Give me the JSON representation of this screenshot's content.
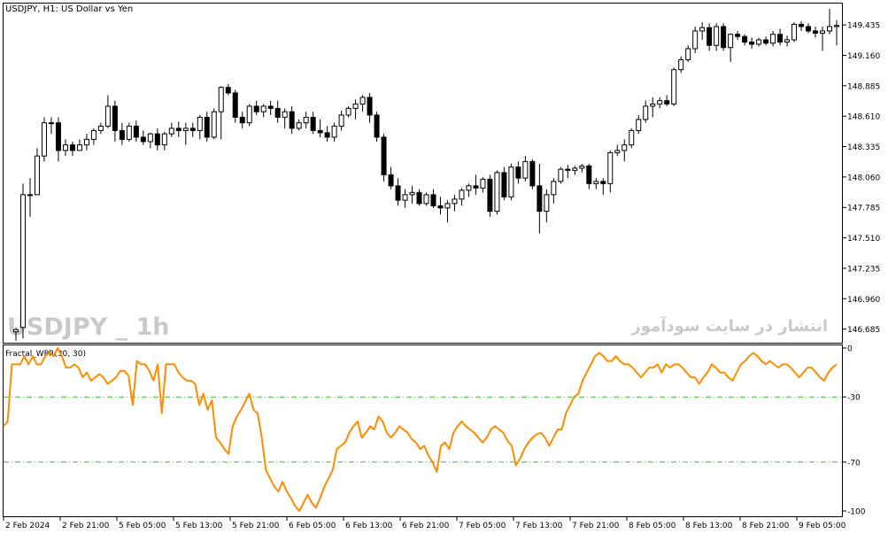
{
  "window": {
    "title": "USDJPY, H1:  US Dollar vs Yen",
    "watermark_left": "USDJPY _ 1h",
    "watermark_right": "انتشار در سایت سودآموز"
  },
  "indicator": {
    "label": "Fractal_WPR(30, 30)",
    "color": "#ff8c00",
    "level_color": "#33bb33",
    "levels": [
      -30,
      -70
    ],
    "tick_labels": [
      "0",
      "-30",
      "-70",
      "-100"
    ]
  },
  "price_axis": {
    "labels": [
      "149.435",
      "149.160",
      "148.885",
      "148.610",
      "148.335",
      "148.060",
      "147.785",
      "147.510",
      "147.235",
      "146.960",
      "146.685"
    ]
  },
  "time_axis": {
    "labels": [
      "2 Feb 2024",
      "2 Feb 21:00",
      "5 Feb 05:00",
      "5 Feb 13:00",
      "5 Feb 21:00",
      "6 Feb 05:00",
      "6 Feb 13:00",
      "6 Feb 21:00",
      "7 Feb 05:00",
      "7 Feb 13:00",
      "7 Feb 21:00",
      "8 Feb 05:00",
      "8 Feb 13:00",
      "8 Feb 21:00",
      "9 Feb 05:00"
    ]
  },
  "chart_data": [
    {
      "type": "candlestick",
      "title": "USDJPY, H1:  US Dollar vs Yen",
      "ylim": [
        146.57,
        149.62
      ],
      "candles": [
        [
          146.66,
          146.7,
          146.58,
          146.68
        ],
        [
          146.7,
          148.0,
          146.6,
          147.9
        ],
        [
          147.9,
          148.05,
          147.7,
          147.9
        ],
        [
          147.9,
          148.32,
          147.9,
          148.25
        ],
        [
          148.25,
          148.6,
          148.2,
          148.55
        ],
        [
          148.55,
          148.6,
          148.45,
          148.55
        ],
        [
          148.55,
          148.6,
          148.2,
          148.3
        ],
        [
          148.3,
          148.4,
          148.25,
          148.35
        ],
        [
          148.35,
          148.38,
          148.25,
          148.3
        ],
        [
          148.3,
          148.4,
          148.3,
          148.35
        ],
        [
          148.35,
          148.45,
          148.3,
          148.4
        ],
        [
          148.4,
          148.5,
          148.35,
          148.48
        ],
        [
          148.48,
          148.55,
          148.45,
          148.52
        ],
        [
          148.52,
          148.8,
          148.5,
          148.7
        ],
        [
          148.7,
          148.75,
          148.38,
          148.48
        ],
        [
          148.48,
          148.55,
          148.35,
          148.4
        ],
        [
          148.4,
          148.55,
          148.38,
          148.52
        ],
        [
          148.52,
          148.57,
          148.38,
          148.42
        ],
        [
          148.42,
          148.48,
          148.35,
          148.38
        ],
        [
          148.38,
          148.46,
          148.32,
          148.45
        ],
        [
          148.45,
          148.5,
          148.3,
          148.35
        ],
        [
          148.35,
          148.47,
          148.3,
          148.45
        ],
        [
          148.45,
          148.55,
          148.42,
          148.5
        ],
        [
          148.5,
          148.56,
          148.42,
          148.48
        ],
        [
          148.48,
          148.55,
          148.35,
          148.5
        ],
        [
          148.5,
          148.55,
          148.42,
          148.48
        ],
        [
          148.48,
          148.62,
          148.4,
          148.6
        ],
        [
          148.6,
          148.65,
          148.38,
          148.42
        ],
        [
          148.42,
          148.68,
          148.4,
          148.65
        ],
        [
          148.65,
          148.88,
          148.4,
          148.87
        ],
        [
          148.87,
          148.9,
          148.8,
          148.82
        ],
        [
          148.82,
          148.85,
          148.55,
          148.6
        ],
        [
          148.6,
          148.65,
          148.5,
          148.55
        ],
        [
          148.55,
          148.72,
          148.52,
          148.7
        ],
        [
          148.7,
          148.75,
          148.62,
          148.65
        ],
        [
          148.65,
          148.72,
          148.6,
          148.7
        ],
        [
          148.7,
          148.75,
          148.62,
          148.68
        ],
        [
          148.68,
          148.75,
          148.55,
          148.6
        ],
        [
          148.6,
          148.68,
          148.5,
          148.65
        ],
        [
          148.65,
          148.7,
          148.45,
          148.5
        ],
        [
          148.5,
          148.58,
          148.48,
          148.55
        ],
        [
          148.55,
          148.65,
          148.5,
          148.6
        ],
        [
          148.6,
          148.65,
          148.45,
          148.48
        ],
        [
          148.48,
          148.58,
          148.42,
          148.46
        ],
        [
          148.46,
          148.52,
          148.38,
          148.42
        ],
        [
          148.42,
          148.55,
          148.38,
          148.52
        ],
        [
          148.52,
          148.66,
          148.48,
          148.62
        ],
        [
          148.62,
          148.7,
          148.6,
          148.68
        ],
        [
          148.68,
          148.76,
          148.58,
          148.72
        ],
        [
          148.72,
          148.8,
          148.65,
          148.78
        ],
        [
          148.78,
          148.82,
          148.55,
          148.62
        ],
        [
          148.62,
          148.65,
          148.38,
          148.42
        ],
        [
          148.42,
          148.45,
          148.02,
          148.08
        ],
        [
          148.08,
          148.15,
          147.95,
          147.98
        ],
        [
          147.98,
          148.05,
          147.8,
          147.85
        ],
        [
          147.85,
          147.95,
          147.78,
          147.9
        ],
        [
          147.9,
          147.98,
          147.82,
          147.92
        ],
        [
          147.92,
          147.95,
          147.8,
          147.82
        ],
        [
          147.82,
          147.92,
          147.8,
          147.9
        ],
        [
          147.9,
          147.95,
          147.78,
          147.8
        ],
        [
          147.8,
          147.88,
          147.72,
          147.78
        ],
        [
          147.78,
          147.85,
          147.65,
          147.82
        ],
        [
          147.82,
          147.9,
          147.75,
          147.86
        ],
        [
          147.86,
          147.96,
          147.8,
          147.94
        ],
        [
          147.94,
          148.0,
          147.88,
          147.98
        ],
        [
          147.98,
          148.08,
          147.9,
          147.96
        ],
        [
          147.96,
          148.06,
          147.92,
          148.04
        ],
        [
          148.04,
          148.08,
          147.7,
          147.75
        ],
        [
          147.75,
          148.12,
          147.72,
          148.1
        ],
        [
          148.1,
          148.15,
          147.85,
          147.88
        ],
        [
          147.88,
          148.18,
          147.85,
          148.15
        ],
        [
          148.15,
          148.2,
          148.0,
          148.05
        ],
        [
          148.05,
          148.25,
          148.02,
          148.2
        ],
        [
          148.2,
          148.22,
          147.95,
          147.98
        ],
        [
          147.98,
          148.18,
          147.55,
          147.75
        ],
        [
          147.75,
          147.95,
          147.65,
          147.9
        ],
        [
          147.9,
          148.05,
          147.82,
          148.02
        ],
        [
          148.02,
          148.15,
          148.0,
          148.13
        ],
        [
          148.13,
          148.17,
          148.05,
          148.12
        ],
        [
          148.12,
          148.16,
          148.08,
          148.14
        ],
        [
          148.14,
          148.18,
          148.1,
          148.16
        ],
        [
          148.16,
          148.18,
          147.95,
          148.0
        ],
        [
          148.0,
          148.05,
          147.95,
          148.02
        ],
        [
          148.02,
          148.05,
          147.9,
          148.0
        ],
        [
          148.0,
          148.3,
          147.92,
          148.28
        ],
        [
          148.28,
          148.35,
          148.25,
          148.3
        ],
        [
          148.3,
          148.4,
          148.2,
          148.35
        ],
        [
          148.35,
          148.5,
          148.32,
          148.48
        ],
        [
          148.48,
          148.62,
          148.45,
          148.58
        ],
        [
          148.58,
          148.75,
          148.55,
          148.7
        ],
        [
          148.7,
          148.78,
          148.6,
          148.72
        ],
        [
          148.72,
          148.78,
          148.68,
          148.75
        ],
        [
          148.75,
          148.8,
          148.7,
          148.72
        ],
        [
          148.72,
          149.05,
          148.7,
          149.03
        ],
        [
          149.03,
          149.15,
          149.0,
          149.12
        ],
        [
          149.12,
          149.25,
          149.1,
          149.22
        ],
        [
          149.22,
          149.42,
          149.18,
          149.38
        ],
        [
          149.38,
          149.46,
          149.3,
          149.41
        ],
        [
          149.41,
          149.45,
          149.2,
          149.25
        ],
        [
          149.25,
          149.45,
          149.2,
          149.42
        ],
        [
          149.42,
          149.45,
          149.2,
          149.23
        ],
        [
          149.23,
          149.36,
          149.1,
          149.35
        ],
        [
          149.35,
          149.38,
          149.3,
          149.33
        ],
        [
          149.33,
          149.35,
          149.25,
          149.28
        ],
        [
          149.28,
          149.32,
          149.22,
          149.26
        ],
        [
          149.26,
          149.32,
          149.24,
          149.3
        ],
        [
          149.3,
          149.33,
          149.25,
          149.27
        ],
        [
          149.27,
          149.38,
          149.24,
          149.35
        ],
        [
          149.35,
          149.4,
          149.25,
          149.28
        ],
        [
          149.28,
          149.34,
          149.24,
          149.3
        ],
        [
          149.3,
          149.46,
          149.28,
          149.44
        ],
        [
          149.44,
          149.47,
          149.38,
          149.42
        ],
        [
          149.42,
          149.45,
          149.36,
          149.38
        ],
        [
          149.38,
          149.42,
          149.32,
          149.36
        ],
        [
          149.36,
          149.42,
          149.2,
          149.38
        ],
        [
          149.38,
          149.58,
          149.35,
          149.42
        ],
        [
          149.42,
          149.48,
          149.25,
          149.43
        ]
      ]
    },
    {
      "type": "line",
      "title": "Fractal_WPR(30, 30)",
      "ylim": [
        -100,
        0
      ],
      "levels": [
        -30,
        -70
      ],
      "values": [
        -48,
        -45,
        -10,
        -10,
        -10,
        -5,
        -10,
        -5,
        -10,
        -10,
        -5,
        -3,
        -5,
        0,
        -5,
        -12,
        -12,
        -10,
        -12,
        -18,
        -15,
        -20,
        -18,
        -16,
        -18,
        -22,
        -20,
        -18,
        -14,
        -14,
        -17,
        -35,
        -8,
        -10,
        -10,
        -14,
        -20,
        -10,
        -40,
        -10,
        -10,
        -10,
        -15,
        -18,
        -20,
        -20,
        -22,
        -35,
        -28,
        -38,
        -32,
        -55,
        -58,
        -62,
        -65,
        -48,
        -42,
        -38,
        -33,
        -28,
        -38,
        -40,
        -55,
        -75,
        -80,
        -85,
        -88,
        -82,
        -88,
        -92,
        -97,
        -100,
        -95,
        -90,
        -95,
        -98,
        -92,
        -85,
        -80,
        -75,
        -62,
        -60,
        -58,
        -52,
        -48,
        -45,
        -55,
        -52,
        -48,
        -50,
        -42,
        -45,
        -52,
        -55,
        -52,
        -48,
        -50,
        -52,
        -56,
        -58,
        -62,
        -60,
        -66,
        -70,
        -76,
        -60,
        -58,
        -62,
        -52,
        -48,
        -45,
        -48,
        -50,
        -52,
        -55,
        -58,
        -55,
        -50,
        -48,
        -50,
        -52,
        -57,
        -60,
        -72,
        -68,
        -62,
        -58,
        -55,
        -53,
        -52,
        -55,
        -60,
        -55,
        -50,
        -50,
        -40,
        -35,
        -30,
        -28,
        -20,
        -15,
        -10,
        -5,
        -3,
        -5,
        -8,
        -8,
        -5,
        -8,
        -10,
        -10,
        -12,
        -15,
        -18,
        -15,
        -12,
        -12,
        -10,
        -15,
        -10,
        -12,
        -10,
        -10,
        -12,
        -15,
        -18,
        -18,
        -22,
        -18,
        -15,
        -10,
        -12,
        -15,
        -15,
        -18,
        -20,
        -15,
        -10,
        -8,
        -5,
        -3,
        -5,
        -8,
        -10,
        -8,
        -10,
        -12,
        -10,
        -10,
        -12,
        -15,
        -18,
        -15,
        -12,
        -12,
        -15,
        -18,
        -20,
        -15,
        -12,
        -10
      ]
    }
  ]
}
